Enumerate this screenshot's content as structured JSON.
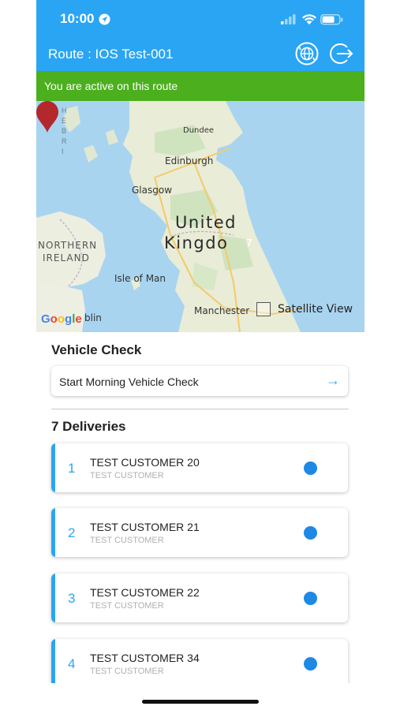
{
  "status_bar": {
    "time": "10:00"
  },
  "header": {
    "title": "Route : IOS Test-001"
  },
  "banner": {
    "text": "You are active on this route"
  },
  "map": {
    "labels": {
      "dundee": "Dundee",
      "edinburgh": "Edinburgh",
      "glasgow": "Glasgow",
      "united": "United",
      "kingdom": "Kingdo",
      "northern": "NORTHERN",
      "ireland": "IRELAND",
      "isle_of_man": "Isle of Man",
      "manchester": "Manchester",
      "dublin": "blin",
      "hebrides": "HEBRI"
    },
    "marker_count": "7",
    "satellite_label": "Satellite View",
    "google_logo": "Google"
  },
  "vehicle_check": {
    "title": "Vehicle Check",
    "button_label": "Start Morning Vehicle Check",
    "arrow": "→"
  },
  "deliveries": {
    "title": "7 Deliveries",
    "items": [
      {
        "number": "1",
        "name": "TEST CUSTOMER 20",
        "subtitle": "TEST CUSTOMER"
      },
      {
        "number": "2",
        "name": "TEST CUSTOMER 21",
        "subtitle": "TEST CUSTOMER"
      },
      {
        "number": "3",
        "name": "TEST CUSTOMER 22",
        "subtitle": "TEST CUSTOMER"
      },
      {
        "number": "4",
        "name": "TEST CUSTOMER 34",
        "subtitle": "TEST CUSTOMER"
      }
    ]
  },
  "colors": {
    "header": "#2aa5f3",
    "banner": "#4caf1e",
    "accent": "#2aa5f3",
    "status_dot": "#1e88e5",
    "marker": "#b3282d"
  },
  "icons": {
    "header_left": "globe-refresh-icon",
    "header_right": "logout-icon"
  }
}
